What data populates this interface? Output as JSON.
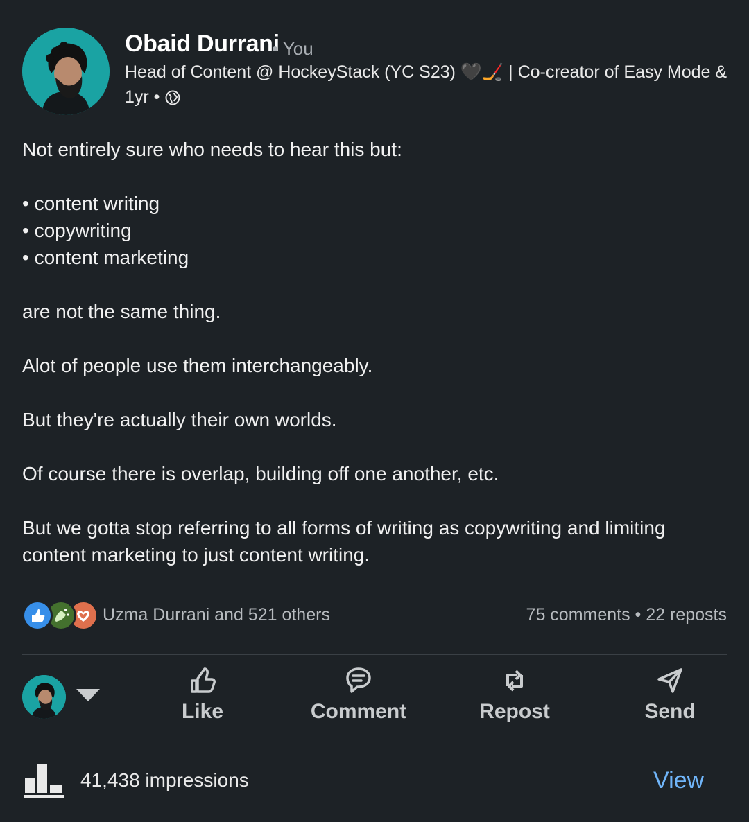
{
  "post": {
    "author": {
      "name": "Obaid Durrani",
      "relation": "• You",
      "headline": "Head of Content @ HockeyStack (YC S23) 🖤🏒 | Co-creator of Easy Mode & ...",
      "time": "1yr •",
      "visibility_icon": "globe-icon"
    },
    "body": {
      "intro": "Not entirely sure who needs to hear this but:",
      "bullets": [
        "• content writing",
        "• copywriting",
        "• content marketing"
      ],
      "p1": "are not the same thing.",
      "p2": "Alot of people use them interchangeably.",
      "p3": "But they're actually their own worlds.",
      "p4": "Of course there is overlap, building off one another, etc.",
      "p5": "But we gotta stop referring to all forms of writing as copywriting and limiting content marketing to just content writing."
    },
    "reactions": {
      "icons": [
        "like-icon",
        "celebrate-icon",
        "love-icon"
      ],
      "summary": "Uzma Durrani and 521 others",
      "engagement": "75 comments • 22 reposts"
    },
    "actions": {
      "like": "Like",
      "comment": "Comment",
      "repost": "Repost",
      "send": "Send"
    },
    "analytics": {
      "impressions": "41,438 impressions",
      "view": "View"
    }
  },
  "colors": {
    "background": "#1d2226",
    "accent_link": "#70b5f9",
    "avatar_bg": "#1aa3a3",
    "like_blue": "#378fe9",
    "celebrate_green": "#44712e",
    "love_orange": "#df704d"
  }
}
